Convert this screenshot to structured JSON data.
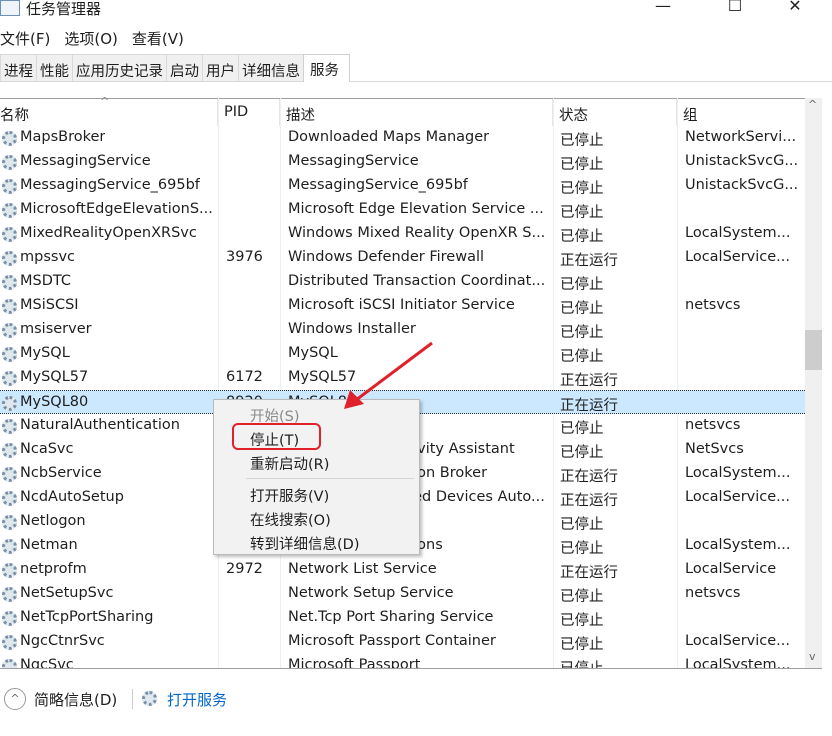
{
  "window": {
    "title": "任务管理器",
    "minimize": "—",
    "maximize": "☐",
    "close": "✕"
  },
  "menubar": [
    "文件(F)",
    "选项(O)",
    "查看(V)"
  ],
  "tabs": [
    "进程",
    "性能",
    "应用历史记录",
    "启动",
    "用户",
    "详细信息",
    "服务"
  ],
  "active_tab": 6,
  "columns": {
    "name": "名称",
    "pid": "PID",
    "desc": "描述",
    "status": "状态",
    "group": "组"
  },
  "rows": [
    {
      "name": "MapsBroker",
      "pid": "",
      "desc": "Downloaded Maps Manager",
      "status": "已停止",
      "group": "NetworkServi..."
    },
    {
      "name": "MessagingService",
      "pid": "",
      "desc": "MessagingService",
      "status": "已停止",
      "group": "UnistackSvcG..."
    },
    {
      "name": "MessagingService_695bf",
      "pid": "",
      "desc": "MessagingService_695bf",
      "status": "已停止",
      "group": "UnistackSvcG..."
    },
    {
      "name": "MicrosoftEdgeElevationS...",
      "pid": "",
      "desc": "Microsoft Edge Elevation Service ...",
      "status": "已停止",
      "group": ""
    },
    {
      "name": "MixedRealityOpenXRSvc",
      "pid": "",
      "desc": "Windows Mixed Reality OpenXR S...",
      "status": "已停止",
      "group": "LocalSystem..."
    },
    {
      "name": "mpssvc",
      "pid": "3976",
      "desc": "Windows Defender Firewall",
      "status": "正在运行",
      "group": "LocalService..."
    },
    {
      "name": "MSDTC",
      "pid": "",
      "desc": "Distributed Transaction Coordinat...",
      "status": "已停止",
      "group": ""
    },
    {
      "name": "MSiSCSI",
      "pid": "",
      "desc": "Microsoft iSCSI Initiator Service",
      "status": "已停止",
      "group": "netsvcs"
    },
    {
      "name": "msiserver",
      "pid": "",
      "desc": "Windows Installer",
      "status": "已停止",
      "group": ""
    },
    {
      "name": "MySQL",
      "pid": "",
      "desc": "MySQL",
      "status": "已停止",
      "group": ""
    },
    {
      "name": "MySQL57",
      "pid": "6172",
      "desc": "MySQL57",
      "status": "正在运行",
      "group": ""
    },
    {
      "name": "MySQL80",
      "pid": "8920",
      "desc": "MySQL80",
      "status": "正在运行",
      "group": "",
      "selected": true
    },
    {
      "name": "NaturalAuthentication",
      "pid": "",
      "desc": "",
      "status": "已停止",
      "group": "netsvcs"
    },
    {
      "name": "NcaSvc",
      "pid": "",
      "desc": "Network Connectivity Assistant",
      "status": "已停止",
      "group": "NetSvcs"
    },
    {
      "name": "NcbService",
      "pid": "",
      "desc": "Network Connection Broker",
      "status": "正在运行",
      "group": "LocalSystem..."
    },
    {
      "name": "NcdAutoSetup",
      "pid": "",
      "desc": "Network Connected Devices Auto...",
      "status": "正在运行",
      "group": "LocalService..."
    },
    {
      "name": "Netlogon",
      "pid": "",
      "desc": "",
      "status": "已停止",
      "group": ""
    },
    {
      "name": "Netman",
      "pid": "",
      "desc": "Network Connections",
      "status": "已停止",
      "group": "LocalSystem..."
    },
    {
      "name": "netprofm",
      "pid": "2972",
      "desc": "Network List Service",
      "status": "正在运行",
      "group": "LocalService"
    },
    {
      "name": "NetSetupSvc",
      "pid": "",
      "desc": "Network Setup Service",
      "status": "已停止",
      "group": "netsvcs"
    },
    {
      "name": "NetTcpPortSharing",
      "pid": "",
      "desc": "Net.Tcp Port Sharing Service",
      "status": "已停止",
      "group": ""
    },
    {
      "name": "NgcCtnrSvc",
      "pid": "",
      "desc": "Microsoft Passport Container",
      "status": "已停止",
      "group": "LocalService..."
    },
    {
      "name": "NgcSvc",
      "pid": "",
      "desc": "Microsoft Passport",
      "status": "已停止",
      "group": "LocalSystem..."
    }
  ],
  "context_menu": {
    "items": [
      {
        "label": "开始(S)",
        "disabled": true
      },
      {
        "label": "停止(T)",
        "highlighted": true
      },
      {
        "label": "重新启动(R)"
      },
      {
        "label": "打开服务(V)"
      },
      {
        "label": "在线搜索(O)"
      },
      {
        "label": "转到详细信息(D)"
      }
    ]
  },
  "footer": {
    "fewer_details": "简略信息(D)",
    "open_services": "打开服务"
  },
  "colors": {
    "selection": "#cce8ff",
    "annotation": "#e0202a",
    "link": "#0066cc"
  }
}
